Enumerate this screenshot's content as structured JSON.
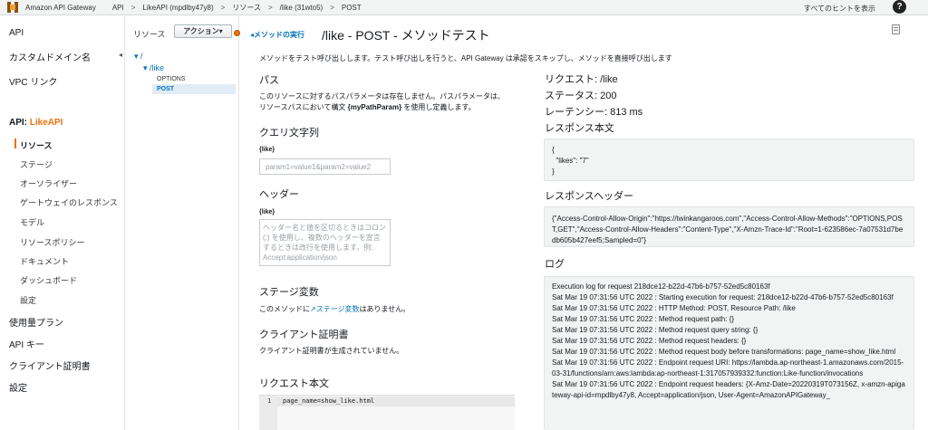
{
  "header": {
    "app_name": "Amazon API Gateway",
    "breadcrumbs": [
      "API",
      "LikeAPI (mpdlby47y8)",
      "リソース",
      "/like (31wto5)",
      "POST"
    ],
    "separator": ">",
    "hints_label": "すべてのヒントを表示",
    "help_label": "?"
  },
  "sidebar": {
    "top_items": [
      "API",
      "カスタムドメイン名",
      "VPC リンク"
    ],
    "api_prefix": "API: ",
    "api_name": "LikeAPI",
    "sub_items": [
      "リソース",
      "ステージ",
      "オーソライザー",
      "ゲートウェイのレスポンス",
      "モデル",
      "リソースポリシー",
      "ドキュメント",
      "ダッシュボード",
      "設定"
    ],
    "bottom_items": [
      "使用量プラン",
      "API キー",
      "クライアント証明書",
      "設定"
    ],
    "collapse_icon": "◂"
  },
  "tree": {
    "title": "リソース",
    "action_label": "アクション▾",
    "root": "/",
    "child": "/like",
    "options": "OPTIONS",
    "post": "POST"
  },
  "main": {
    "back_link": "◂メソッドの実行",
    "title": "/like - POST - メソッドテスト",
    "intro": "メソッドをテスト呼び出しします。テスト呼び出しを行うと、API Gateway は承認をスキップし、メソッドを直接呼び出します",
    "path": {
      "heading": "パス",
      "desc_line1": "このリソースに対するパスパラメータは存在しません。パスパラメータは、",
      "desc_line2_pre": "リソースパスにおいて構文 ",
      "desc_line2_bold": "{myPathParam}",
      "desc_line2_post": " を使用し定義します。"
    },
    "query": {
      "heading": "クエリ文字列",
      "label": "{like}",
      "placeholder": "param1=value1&param2=value2"
    },
    "headers": {
      "heading": "ヘッダー",
      "label": "{like}",
      "placeholder": "ヘッダー名と値を区切るときはコロン (:) を使用し、複数のヘッダーを宣言するときは改行を使用します。例: Accept:application/json"
    },
    "stage": {
      "heading": "ステージ変数",
      "pre": "このメソッドに",
      "link": "ステージ変数",
      "post": "はありません。"
    },
    "cert": {
      "heading": "クライアント証明書",
      "desc": "クライアント証明書が生成されていません。"
    },
    "body": {
      "heading": "リクエスト本文",
      "line_number": "1",
      "content": "page_name=show_like.html"
    }
  },
  "result": {
    "request": "リクエスト: /like",
    "status": "ステータス: 200",
    "latency": "レーテンシー: 813 ms",
    "body_heading": "レスポンス本文",
    "body_text": "{\n  \"likes\": \"7\"\n}",
    "headers_heading": "レスポンスヘッダー",
    "headers_text": "{\"Access-Control-Allow-Origin\":\"https://twinkangaroos.com\",\"Access-Control-Allow-Methods\":\"OPTIONS,POST,GET\",\"Access-Control-Allow-Headers\":\"Content-Type\",\"X-Amzn-Trace-Id\":\"Root=1-623586ec-7a07531d7bedb605b427eef5;Sampled=0\"}",
    "log_heading": "ログ",
    "log_lines": [
      "Execution log for request 218dce12-b22d-47b6-b757-52ed5c80163f",
      "Sat Mar 19 07:31:56 UTC 2022 : Starting execution for request: 218dce12-b22d-47b6-b757-52ed5c80163f",
      "Sat Mar 19 07:31:56 UTC 2022 : HTTP Method: POST, Resource Path: /like",
      "Sat Mar 19 07:31:56 UTC 2022 : Method request path: {}",
      "Sat Mar 19 07:31:56 UTC 2022 : Method request query string: {}",
      "Sat Mar 19 07:31:56 UTC 2022 : Method request headers: {}",
      "Sat Mar 19 07:31:56 UTC 2022 : Method request body before transformations: page_name=show_like.html",
      "Sat Mar 19 07:31:56 UTC 2022 : Endpoint request URI: https://lambda.ap-northeast-1.amazonaws.com/2015-03-31/functions/arn:aws:lambda:ap-northeast-1:317057939332:function:Like-function/invocations",
      "Sat Mar 19 07:31:56 UTC 2022 : Endpoint request headers: {X-Amz-Date=20220319T073156Z, x-amzn-apigateway-api-id=mpdlby47y8, Accept=application/json, User-Agent=AmazonAPIGateway_"
    ]
  }
}
